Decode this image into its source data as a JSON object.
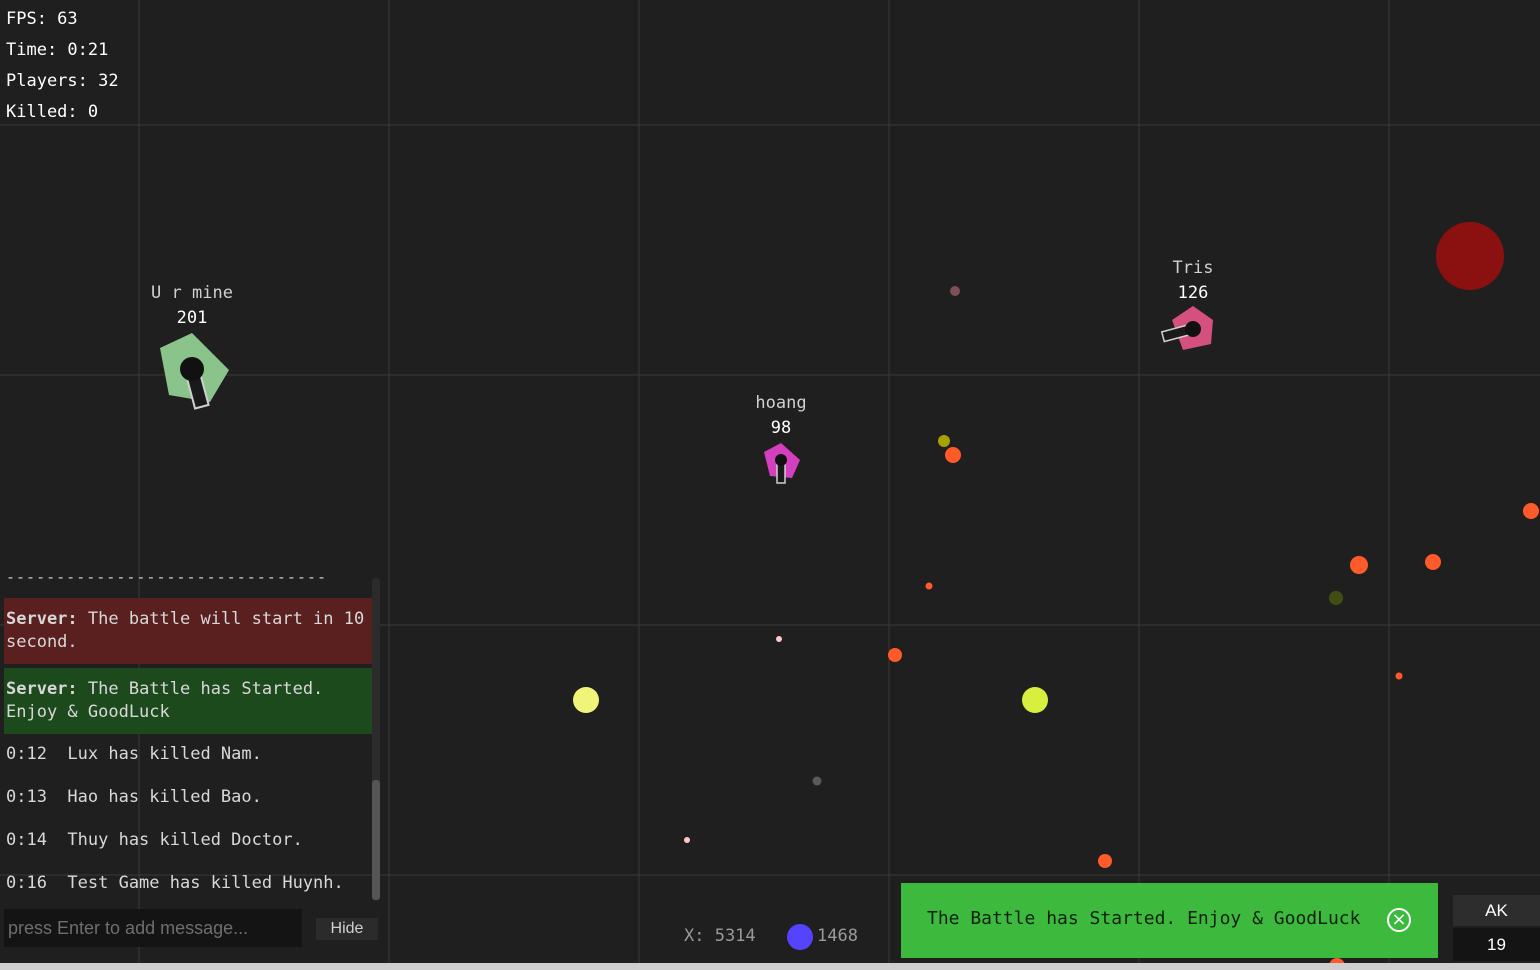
{
  "hud": {
    "fps": "FPS: 63",
    "time": "Time: 0:21",
    "players": "Players: 32",
    "killed": "Killed: 0"
  },
  "players": [
    {
      "name": "U r mine",
      "score": "201",
      "color": "#8bc48b"
    },
    {
      "name": "hoang",
      "score": "98",
      "color": "#d43fc0"
    },
    {
      "name": "Tris",
      "score": "126",
      "color": "#d4507e"
    }
  ],
  "chat": {
    "separator": "--------------------------------",
    "messages": [
      {
        "who": "Server:",
        "text": " The battle will start in 10 second.",
        "style": "red"
      },
      {
        "who": "Server:",
        "text": " The Battle has Started. Enjoy & GoodLuck",
        "style": "green"
      },
      {
        "who": "",
        "text": "0:12  Lux has killed Nam.",
        "style": "plain"
      },
      {
        "who": "",
        "text": "0:13  Hao has killed Bao.",
        "style": "plain"
      },
      {
        "who": "",
        "text": "0:14  Thuy has killed Doctor.",
        "style": "plain"
      },
      {
        "who": "",
        "text": "0:16  Test Game has killed Huynh.",
        "style": "plain"
      }
    ],
    "input_placeholder": "press Enter to add message...",
    "hide_label": "Hide"
  },
  "coords": {
    "x_label": "X: 5314",
    "y_label": "1468"
  },
  "notification": {
    "text": "The Battle has Started. Enjoy & GoodLuck",
    "close_icon": "close-circle-icon"
  },
  "weapon": {
    "name": "AK",
    "ammo": "19"
  },
  "colors": {
    "background": "#1f1f1f",
    "grid": "#3a3a3a",
    "orb_orange": "#ff5a2a",
    "orb_yellow": "#f0f57a",
    "orb_red_big": "#8b1010",
    "notice_green": "#3dba3d",
    "self_marker": "#5544ff"
  }
}
